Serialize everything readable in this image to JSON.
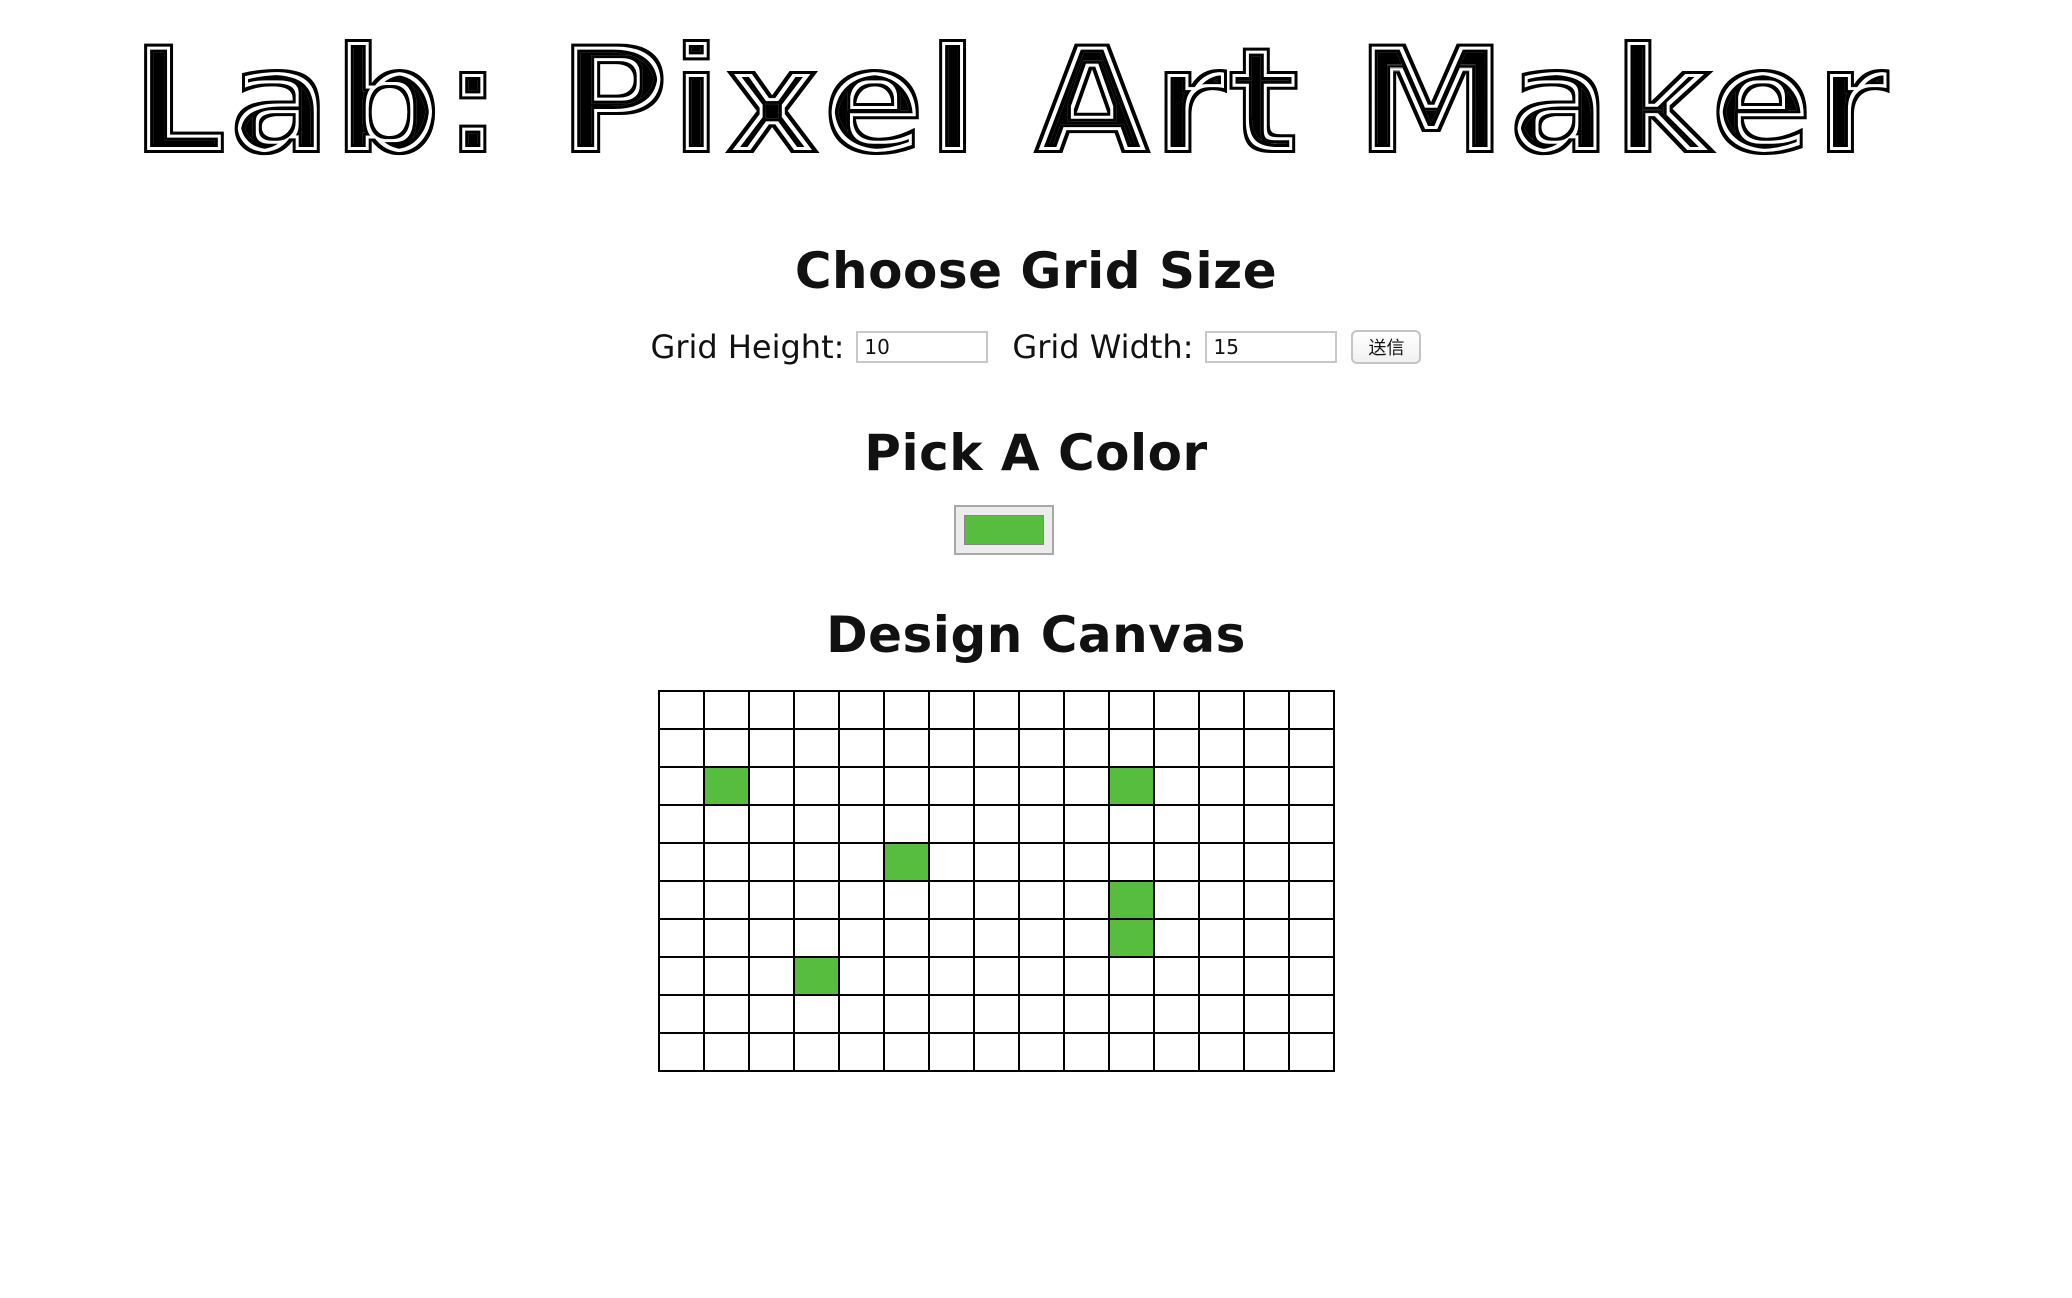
{
  "page": {
    "title": "Lab: Pixel Art Maker"
  },
  "grid_size": {
    "heading": "Choose Grid Size",
    "height_label": "Grid Height:",
    "height_value": "10",
    "width_label": "Grid Width:",
    "width_value": "15",
    "submit_label": "送信"
  },
  "color": {
    "heading": "Pick A Color",
    "value": "#56bd3f"
  },
  "canvas": {
    "heading": "Design Canvas",
    "rows": 10,
    "cols": 15,
    "empty_color": "#ffffff",
    "filled_cells": [
      {
        "row": 2,
        "col": 1
      },
      {
        "row": 2,
        "col": 10
      },
      {
        "row": 4,
        "col": 5
      },
      {
        "row": 5,
        "col": 10
      },
      {
        "row": 6,
        "col": 10
      },
      {
        "row": 7,
        "col": 3
      }
    ]
  }
}
